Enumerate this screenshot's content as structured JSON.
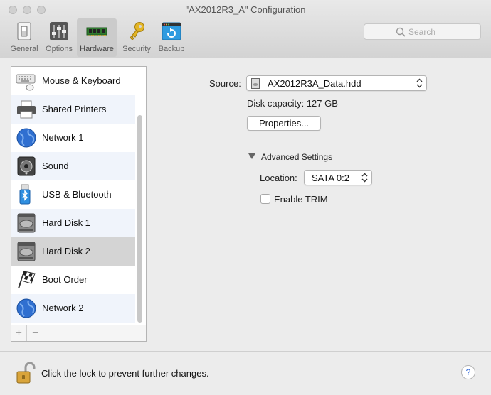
{
  "window": {
    "title": "\"AX2012R3_A\" Configuration"
  },
  "toolbar": {
    "items": [
      {
        "label": "General",
        "icon": "switch-icon"
      },
      {
        "label": "Options",
        "icon": "sliders-icon"
      },
      {
        "label": "Hardware",
        "icon": "memory-chip-icon",
        "selected": true
      },
      {
        "label": "Security",
        "icon": "key-icon"
      },
      {
        "label": "Backup",
        "icon": "backup-icon"
      }
    ],
    "search_placeholder": "Search"
  },
  "devices": [
    {
      "label": "Mouse & Keyboard",
      "icon": "keyboard-icon"
    },
    {
      "label": "Shared Printers",
      "icon": "printer-icon"
    },
    {
      "label": "Network 1",
      "icon": "globe-icon"
    },
    {
      "label": "Sound",
      "icon": "speaker-icon"
    },
    {
      "label": "USB & Bluetooth",
      "icon": "usb-bluetooth-icon"
    },
    {
      "label": "Hard Disk 1",
      "icon": "hard-disk-icon"
    },
    {
      "label": "Hard Disk 2",
      "icon": "hard-disk-icon",
      "selected": true
    },
    {
      "label": "Boot Order",
      "icon": "checkered-flag-icon"
    },
    {
      "label": "Network 2",
      "icon": "globe-icon"
    }
  ],
  "list_buttons": {
    "add": "+",
    "remove": "−"
  },
  "detail": {
    "source_label": "Source:",
    "source_value": "AX2012R3A_Data.hdd",
    "disk_capacity": "Disk capacity: 127 GB",
    "properties_button": "Properties...",
    "advanced_settings": "Advanced Settings",
    "location_label": "Location:",
    "location_value": "SATA 0:2",
    "enable_trim_label": "Enable TRIM",
    "enable_trim_checked": false
  },
  "footer": {
    "lock_text": "Click the lock to prevent further changes.",
    "help": "?"
  },
  "colors": {
    "selected_row": "#d4d4d4",
    "alt_row": "#f0f4fb",
    "accent": "#3a6fd8"
  }
}
